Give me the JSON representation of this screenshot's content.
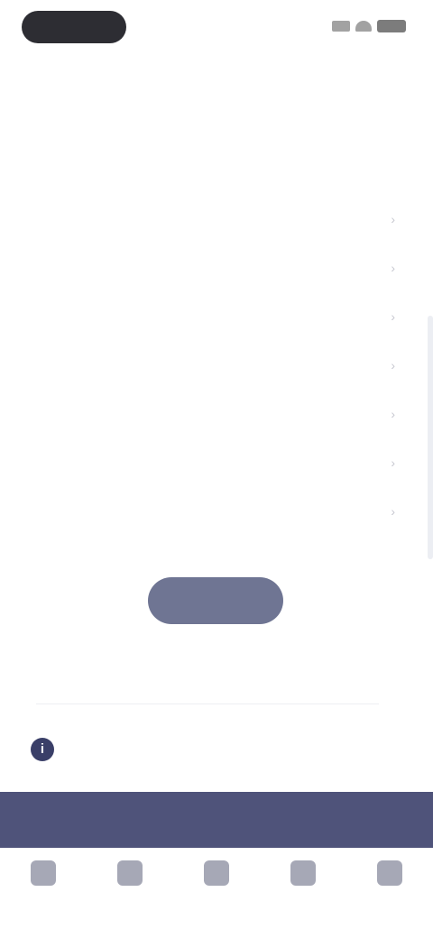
{
  "status_bar": {
    "icons": [
      "signal-icon",
      "wifi-icon",
      "battery-icon"
    ]
  },
  "header": {
    "title": ""
  },
  "intro": {
    "title": "",
    "subtitle": ""
  },
  "options": [
    {
      "label": ""
    },
    {
      "label": ""
    },
    {
      "label": ""
    },
    {
      "label": ""
    },
    {
      "label": ""
    },
    {
      "label": ""
    },
    {
      "label": ""
    }
  ],
  "submit": {
    "label": ""
  },
  "help": {
    "icon": "info-icon",
    "text": ""
  },
  "banner": {
    "text": ""
  },
  "bottom_nav": [
    {
      "icon": "home-icon",
      "label": ""
    },
    {
      "icon": "calendar-icon",
      "label": ""
    },
    {
      "icon": "bell-icon",
      "label": ""
    },
    {
      "icon": "chat-icon",
      "label": ""
    },
    {
      "icon": "profile-icon",
      "label": ""
    }
  ],
  "colors": {
    "primary": "#4f537a",
    "button": "#6f7593",
    "text": "#3a3c4c"
  }
}
